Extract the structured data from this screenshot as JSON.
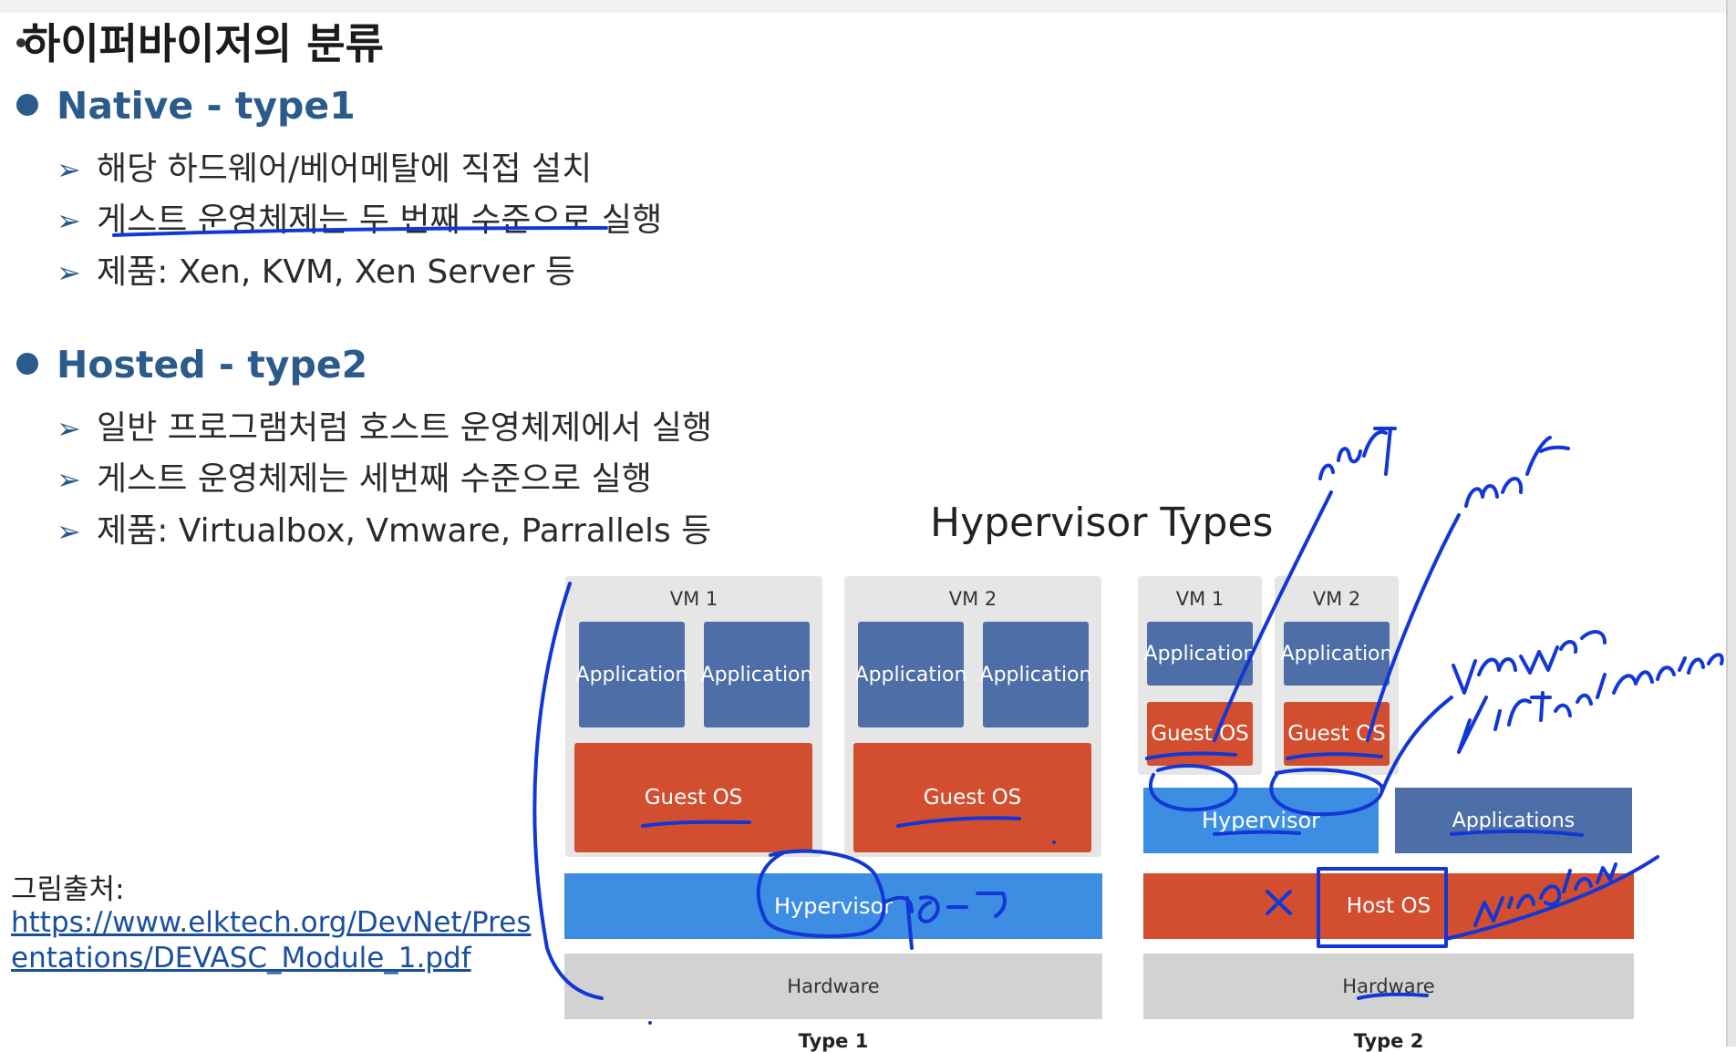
{
  "title": "하이퍼바이저의 분류",
  "native": {
    "heading": "Native - type1",
    "items": [
      "해당 하드웨어/베어메탈에 직접 설치",
      "게스트 운영체제는 두 번째 수준으로 실행",
      "제품: Xen, KVM, Xen Server 등"
    ]
  },
  "hosted": {
    "heading": "Hosted - type2",
    "items": [
      "일반 프로그램처럼 호스트 운영체제에서 실행",
      "게스트 운영체제는 세번째 수준으로 실행",
      "제품: Virtualbox, Vmware, Parrallels 등"
    ]
  },
  "arrow_glyph": "➢",
  "credit": {
    "label": "그림출처:",
    "link": "https://www.elktech.org/DevNet/Presentations/DEVASC_Module_1.pdf"
  },
  "diagram": {
    "title": "Hypervisor Types",
    "type1": {
      "caption": "Type 1",
      "vm1": {
        "label": "VM 1",
        "app1": "Application",
        "app2": "Application",
        "guest": "Guest OS"
      },
      "vm2": {
        "label": "VM 2",
        "app1": "Application",
        "app2": "Application",
        "guest": "Guest OS"
      },
      "hypervisor": "Hypervisor",
      "hardware": "Hardware"
    },
    "type2": {
      "caption": "Type 2",
      "vm1": {
        "label": "VM 1",
        "app": "Application",
        "guest": "Guest OS"
      },
      "vm2": {
        "label": "VM 2",
        "app": "Application",
        "guest": "Guest OS"
      },
      "hypervisor": "Hypervisor",
      "applications": "Applications",
      "hostos": "Host OS",
      "hardware": "Hardware"
    }
  },
  "colors": {
    "heading_blue": "#2a5b8a",
    "app_blue": "#4d6ea6",
    "guest_red": "#d24e2f",
    "hypervisor_blue": "#3d8ee3",
    "hardware_gray": "#d2d2d2",
    "ink_blue": "#1237d6"
  }
}
